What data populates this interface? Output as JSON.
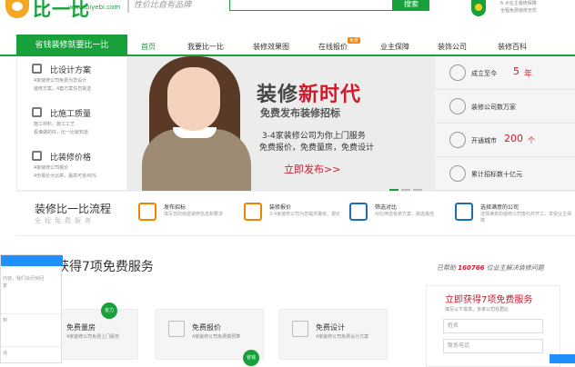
{
  "header": {
    "brand": "比一比",
    "domain": "www.biyebi.com",
    "slogan": "性价比自有品牌",
    "search_button": "搜索",
    "guarantee_lines": [
      "6 大业主装修保障",
      "全程免费装修无忧"
    ]
  },
  "nav": {
    "category_label": "省钱装修就要比一比",
    "items": [
      "首页",
      "我要比一比",
      "装修效果图",
      "在线报价",
      "业主保障",
      "装饰公司",
      "装修百科"
    ],
    "hot_badge": "免费"
  },
  "left_categories": [
    {
      "title": "比设计方案",
      "desc": [
        "4家装修公司免费为您设计",
        "装修方案，4套方案任您挑选"
      ]
    },
    {
      "title": "比施工质量",
      "desc": [
        "施工材料，施工工艺",
        "看谁做的好，比一比就知道"
      ]
    },
    {
      "title": "比装修价格",
      "desc": [
        "4家装修公司报价",
        "4份报价大比拼，最高可省40%"
      ]
    }
  ],
  "banner": {
    "headline_part1": "装修",
    "headline_part2": "新时代",
    "subhead": "免费发布装修招标",
    "line1": "3-4家装修公司为你上门服务",
    "line2": "免费报价，免费量房，免费设计",
    "cta": "立即发布>>"
  },
  "stats": [
    {
      "label": "成立至今",
      "value": "5",
      "unit": "年"
    },
    {
      "label": "装修公司数万家",
      "value": "",
      "unit": ""
    },
    {
      "label": "开通城市",
      "value": "200",
      "unit": "个"
    },
    {
      "label": "累计招标数十亿元",
      "value": "",
      "unit": ""
    }
  ],
  "process": {
    "title": "装修比一比流程",
    "subtitle": "全程免费服务",
    "steps": [
      {
        "title": "发布招标",
        "desc": "填写您的房屋装修信息和要求"
      },
      {
        "title": "装修报价",
        "desc": "3-4家装修公司为您提供量房、报价"
      },
      {
        "title": "筛选对比",
        "desc": "对比筛选各家方案，挑选最佳"
      },
      {
        "title": "选择满意的公司",
        "desc": "选择满意的装修公司签约并开工，享受业主保障"
      }
    ]
  },
  "services": {
    "title": "获得7项免费服务",
    "helped_prefix": "已帮助",
    "helped_count": "160766",
    "helped_suffix": "位业主解决装修问题",
    "cards": [
      {
        "name": "免费量房",
        "desc": "4家装修公司免费上门服务",
        "tag": "省力"
      },
      {
        "name": "免费报价",
        "desc": "4家装修公司免费做预算",
        "tag": ""
      },
      {
        "name": "免费设计",
        "desc": "4家装修公司免费设计方案",
        "tag": ""
      }
    ],
    "bottom_tag": "省钱"
  },
  "form": {
    "title": "立即获得7项免费服务",
    "subtitle": "填写以下需求，多家公司任君比",
    "name_placeholder": "姓名",
    "phone_placeholder": "联系电话"
  },
  "chat": {
    "lines": [
      "内容，我们会尽快回",
      "复"
    ],
    "field1": "称",
    "field2": "话"
  }
}
